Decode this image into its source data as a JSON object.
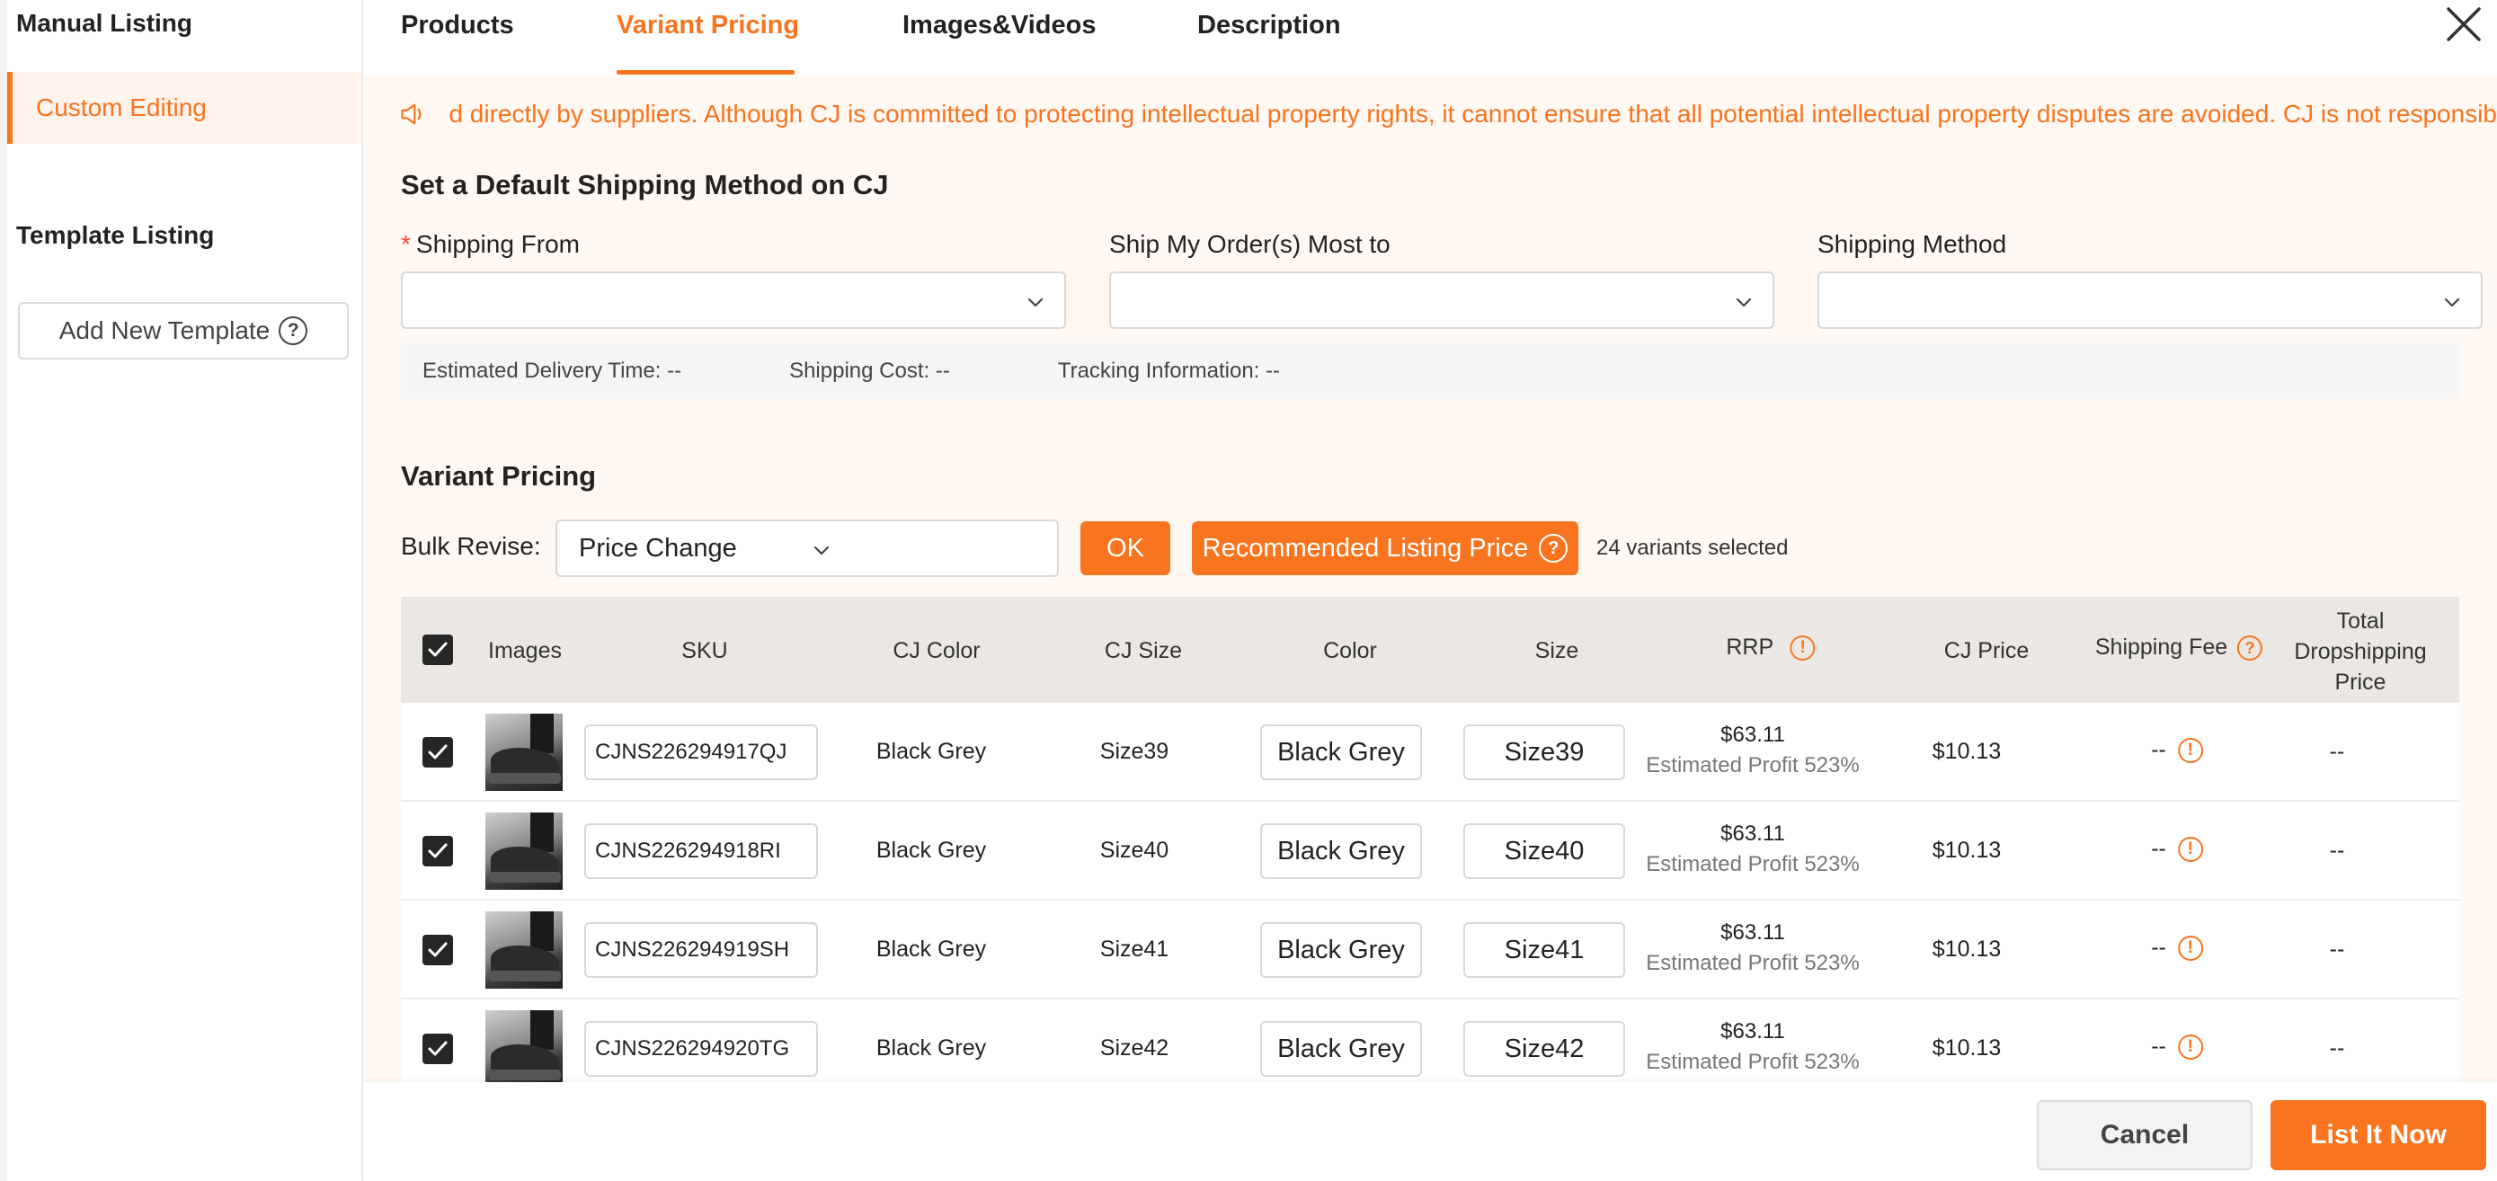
{
  "sidebar": {
    "manual_listing": "Manual Listing",
    "custom_editing": "Custom Editing",
    "template_listing": "Template Listing",
    "add_new_template": "Add New Template",
    "help_glyph": "?"
  },
  "tabs": [
    {
      "label": "Products",
      "active": false
    },
    {
      "label": "Variant Pricing",
      "active": true
    },
    {
      "label": "Images&Videos",
      "active": false
    },
    {
      "label": "Description",
      "active": false
    }
  ],
  "notice": {
    "icon": "speaker-icon",
    "text": "d directly by suppliers. Although CJ is committed to protecting intellectual property rights, it cannot ensure that all potential intellectual property disputes are avoided. CJ is not responsib"
  },
  "shipping": {
    "title": "Set a Default Shipping Method on CJ",
    "required_mark": "*",
    "from_label": "Shipping From",
    "to_label": "Ship My Order(s) Most to",
    "method_label": "Shipping Method",
    "delivery_time": "Estimated Delivery Time: --",
    "shipping_cost": "Shipping Cost: --",
    "tracking": "Tracking Information: --"
  },
  "variant_pricing": {
    "title": "Variant Pricing",
    "bulk_label": "Bulk Revise:",
    "bulk_select_value": "Price Change",
    "ok_label": "OK",
    "recommended_label": "Recommended Listing Price",
    "help_glyph": "?",
    "selected_count": "24 variants selected"
  },
  "table": {
    "headers": {
      "images": "Images",
      "sku": "SKU",
      "cj_color": "CJ Color",
      "cj_size": "CJ Size",
      "color": "Color",
      "size": "Size",
      "rrp": "RRP",
      "cj_price": "CJ Price",
      "shipping_fee": "Shipping Fee",
      "total_line1": "Total",
      "total_line2": "Dropshipping",
      "total_line3": "Price"
    },
    "warn_glyph": "!",
    "help_glyph": "?",
    "rows": [
      {
        "sku": "CJNS226294917QJ",
        "cj_color": "Black Grey",
        "cj_size": "Size39",
        "color": "Black Grey",
        "size": "Size39",
        "rrp": "$63.11",
        "profit": "Estimated Profit 523%",
        "cj_price": "$10.13",
        "shipping_fee": "--",
        "total": "--"
      },
      {
        "sku": "CJNS226294918RI",
        "cj_color": "Black Grey",
        "cj_size": "Size40",
        "color": "Black Grey",
        "size": "Size40",
        "rrp": "$63.11",
        "profit": "Estimated Profit 523%",
        "cj_price": "$10.13",
        "shipping_fee": "--",
        "total": "--"
      },
      {
        "sku": "CJNS226294919SH",
        "cj_color": "Black Grey",
        "cj_size": "Size41",
        "color": "Black Grey",
        "size": "Size41",
        "rrp": "$63.11",
        "profit": "Estimated Profit 523%",
        "cj_price": "$10.13",
        "shipping_fee": "--",
        "total": "--"
      },
      {
        "sku": "CJNS226294920TG",
        "cj_color": "Black Grey",
        "cj_size": "Size42",
        "color": "Black Grey",
        "size": "Size42",
        "rrp": "$63.11",
        "profit": "Estimated Profit 523%",
        "cj_price": "$10.13",
        "shipping_fee": "--",
        "total": "--"
      }
    ]
  },
  "footer": {
    "cancel_label": "Cancel",
    "list_label": "List It Now"
  },
  "colors": {
    "accent": "#f9741e",
    "banner_bg": "#fff8f3",
    "table_header_bg": "#ebe8e3"
  }
}
